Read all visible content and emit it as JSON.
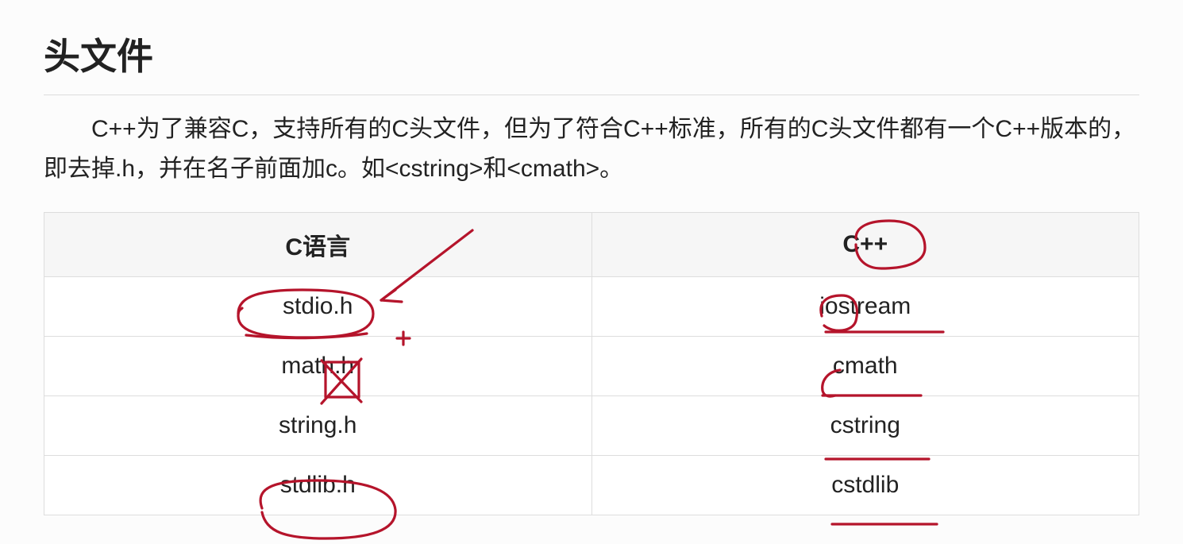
{
  "title": "头文件",
  "paragraph": "C++为了兼容C，支持所有的C头文件，但为了符合C++标准，所有的C头文件都有一个C++版本的，即去掉.h，并在名子前面加c。如<cstring>和<cmath>。",
  "table": {
    "headers": [
      "C语言",
      "C++"
    ],
    "rows": [
      [
        "stdio.h",
        "iostream"
      ],
      [
        "math.h",
        "cmath"
      ],
      [
        "string.h",
        "cstring"
      ],
      [
        "stdlib.h",
        "cstdlib"
      ]
    ]
  },
  "annotation_color": "#b5142b"
}
